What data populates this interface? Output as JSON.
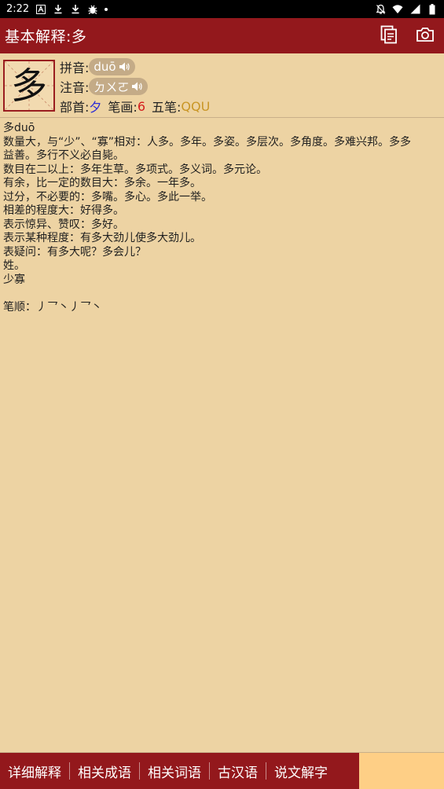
{
  "status_bar": {
    "time": "2:22",
    "left_icons": [
      "a-icon",
      "download-icon",
      "download-icon",
      "bug-icon",
      "dot-icon"
    ],
    "right_icons": [
      "bell-off-icon",
      "wifi-icon",
      "signal-icon",
      "battery-icon"
    ]
  },
  "app_bar": {
    "title": "基本解释:多",
    "actions": [
      "copy-icon",
      "camera-icon"
    ]
  },
  "character": {
    "glyph": "多",
    "pinyin_label": "拼音:",
    "pinyin": "duō",
    "zhuyin_label": "注音:",
    "zhuyin": "ㄉㄨㄛ",
    "radical_label": "部首:",
    "radical": "夕",
    "strokes_label": "笔画:",
    "strokes": "6",
    "wubi_label": "五笔:",
    "wubi": "QQU"
  },
  "definition_lines": [
    "多duō",
    "数量大，与“少”、“寡”相对：人多。多年。多姿。多层次。多角度。多难兴邦。多多",
    "益善。多行不义必自毙。",
    "数目在二以上：多年生草。多项式。多义词。多元论。",
    "有余，比一定的数目大：多余。一年多。",
    "过分，不必要的：多嘴。多心。多此一举。",
    "相差的程度大：好得多。",
    "表示惊异、赞叹：多好。",
    "表示某种程度：有多大劲儿使多大劲儿。",
    "表疑问：有多大呢？多会儿？",
    "姓。",
    "少寡",
    "",
    "笔顺：丿乛丶丿乛丶"
  ],
  "tabs": [
    "详细解释",
    "相关成语",
    "相关词语",
    "古汉语",
    "说文解字"
  ],
  "colors": {
    "app_bar": "#93181c",
    "background": "#edd3a3",
    "pill": "#c4ab87",
    "radical": "#2b2bd6",
    "strokes": "#d41c1c",
    "wubi": "#c99626",
    "tab_filler": "#fecf86"
  }
}
